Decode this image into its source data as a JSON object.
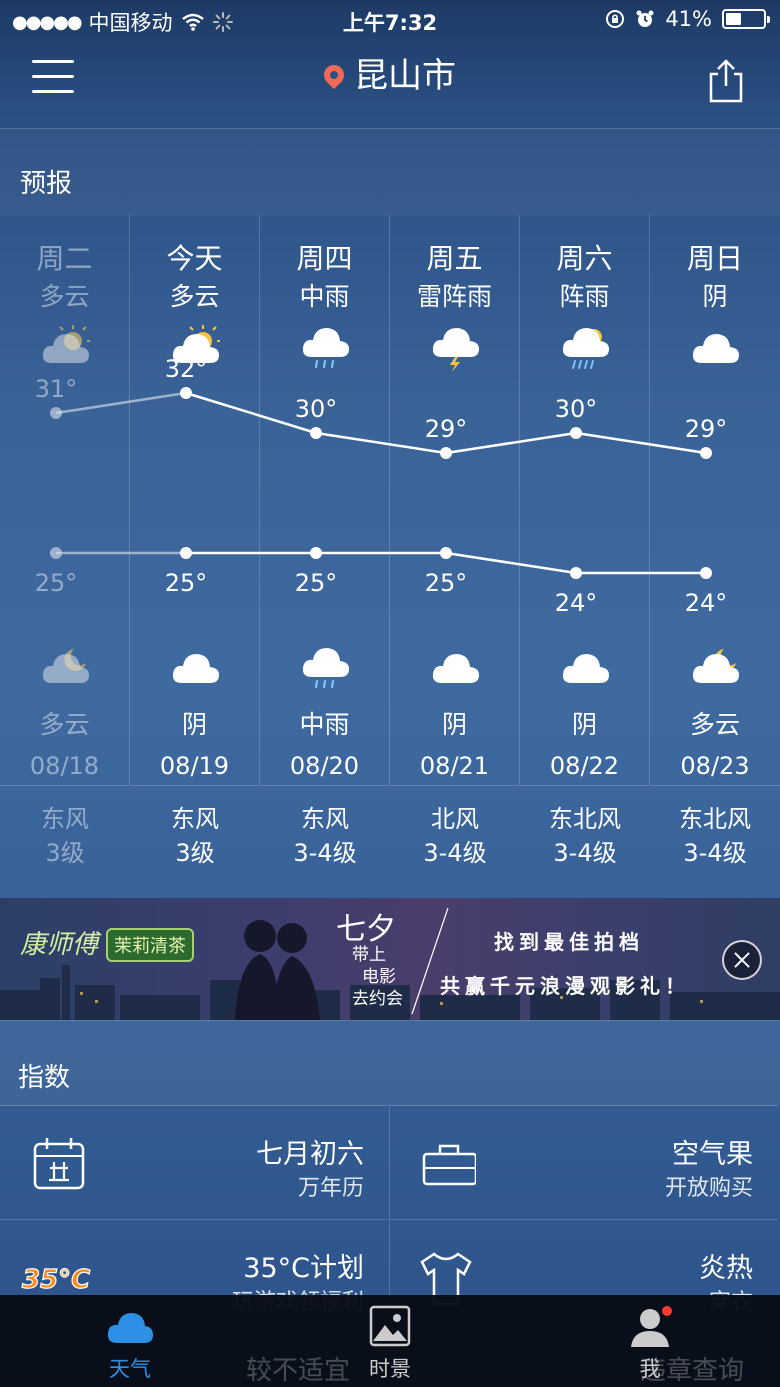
{
  "status_bar": {
    "signal": "●●●●●",
    "carrier": "中国移动",
    "time": "上午7:32",
    "battery": "41%",
    "battery_level": 0.41
  },
  "header": {
    "city": "昆山市"
  },
  "forecast": {
    "title": "预报",
    "days": [
      {
        "day": "周二",
        "weather_day": "多云",
        "high": "31°",
        "low": "25°",
        "weather_night": "多云",
        "date": "08/18",
        "past": true,
        "icon_day": "partly-cloudy-sun-icon",
        "icon_night": "partly-cloudy-moon-icon"
      },
      {
        "day": "今天",
        "weather_day": "多云",
        "high": "32°",
        "low": "25°",
        "weather_night": "阴",
        "date": "08/19",
        "past": false,
        "icon_day": "partly-cloudy-sun-icon",
        "icon_night": "cloud-icon"
      },
      {
        "day": "周四",
        "weather_day": "中雨",
        "high": "30°",
        "low": "25°",
        "weather_night": "中雨",
        "date": "08/20",
        "past": false,
        "icon_day": "rain-icon",
        "icon_night": "rain-icon"
      },
      {
        "day": "周五",
        "weather_day": "雷阵雨",
        "high": "29°",
        "low": "25°",
        "weather_night": "阴",
        "date": "08/21",
        "past": false,
        "icon_day": "thunderstorm-icon",
        "icon_night": "cloud-icon"
      },
      {
        "day": "周六",
        "weather_day": "阵雨",
        "high": "30°",
        "low": "24°",
        "weather_night": "阴",
        "date": "08/22",
        "past": false,
        "icon_day": "shower-icon",
        "icon_night": "cloud-icon"
      },
      {
        "day": "周日",
        "weather_day": "阴",
        "high": "29°",
        "low": "24°",
        "weather_night": "多云",
        "date": "08/23",
        "past": false,
        "icon_day": "cloud-icon",
        "icon_night": "partly-cloudy-moon-icon"
      }
    ],
    "highs": [
      31,
      32,
      30,
      29,
      30,
      29
    ],
    "lows": [
      25,
      25,
      25,
      25,
      24,
      24
    ]
  },
  "wind": [
    {
      "dir": "东风",
      "level": "3级"
    },
    {
      "dir": "东风",
      "level": "3级"
    },
    {
      "dir": "东风",
      "level": "3-4级"
    },
    {
      "dir": "北风",
      "level": "3-4级"
    },
    {
      "dir": "东北风",
      "level": "3-4级"
    },
    {
      "dir": "东北风",
      "level": "3-4级"
    }
  ],
  "ad": {
    "brand": "康师傅",
    "product": "茉莉清茶",
    "headline": "七夕",
    "sub1": "带上",
    "sub2": "电影",
    "sub3": "去约会",
    "line1": "找到最佳拍档",
    "line2": "共赢千元浪漫观影礼！"
  },
  "indices": {
    "title": "指数",
    "items": [
      {
        "main": "七月初六",
        "sub": "万年历",
        "icon": "calendar-icon"
      },
      {
        "main": "空气果",
        "sub": "开放购买",
        "icon": "shopping-bag-icon"
      },
      {
        "main": "35°C计划",
        "sub": "玩游戏领福利",
        "icon": "35c-logo-icon"
      },
      {
        "main": "炎热",
        "sub": "穿衣",
        "icon": "shirt-icon"
      }
    ],
    "ghost_row": [
      "较不适宜",
      "违章查询"
    ]
  },
  "tabbar": {
    "tabs": [
      {
        "label": "天气",
        "icon": "cloud-icon",
        "active": true
      },
      {
        "label": "时景",
        "icon": "photo-icon",
        "active": false
      },
      {
        "label": "我",
        "icon": "user-icon",
        "active": false
      }
    ]
  },
  "colors": {
    "accent": "#2e8fe6",
    "pin": "#f06a55",
    "badge": "#ff3b30"
  }
}
